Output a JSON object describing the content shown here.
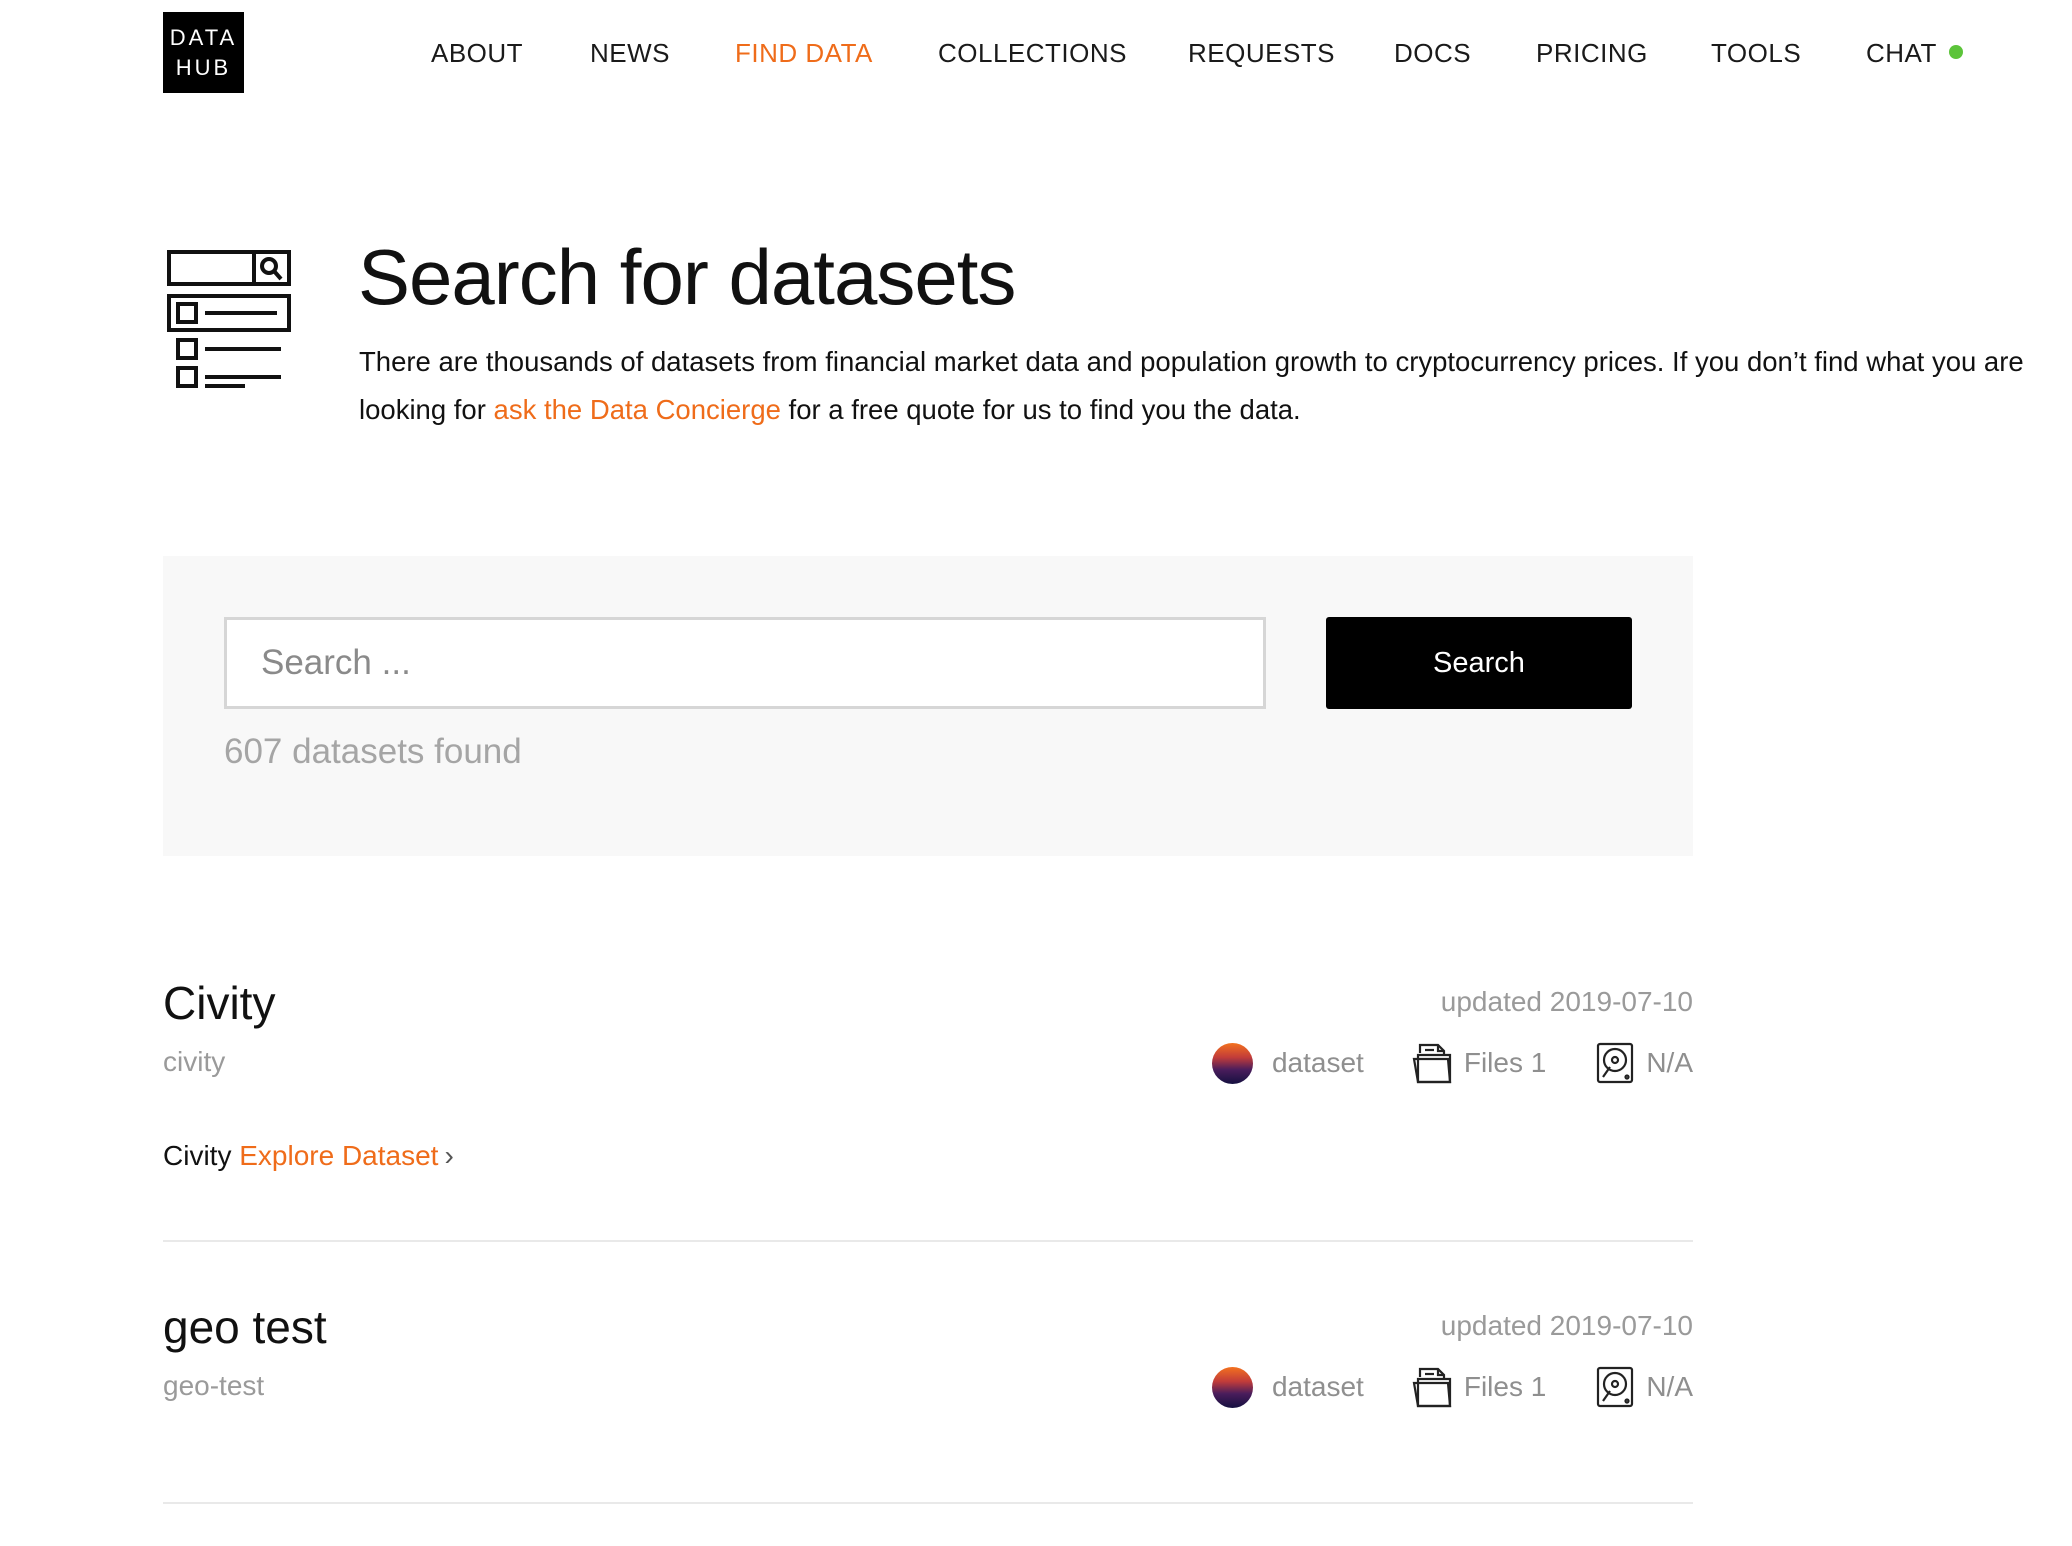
{
  "logo": {
    "line1": "DATA",
    "line2": "HUB"
  },
  "nav": {
    "items": [
      {
        "label": "ABOUT"
      },
      {
        "label": "NEWS"
      },
      {
        "label": "FIND DATA",
        "active": true
      },
      {
        "label": "COLLECTIONS"
      },
      {
        "label": "REQUESTS"
      },
      {
        "label": "DOCS"
      },
      {
        "label": "PRICING"
      },
      {
        "label": "TOOLS"
      },
      {
        "label": "CHAT"
      }
    ],
    "chat_status_color": "#5cc43a"
  },
  "hero": {
    "icon": "search-results-icon",
    "title": "Search for datasets",
    "desc_before": "There are thousands of datasets from financial market data and population growth to cryptocurrency prices. If you don’t find what you are looking for ",
    "desc_link": "ask the Data Concierge",
    "desc_after": " for a free quote for us to find you the data."
  },
  "search": {
    "placeholder": "Search ...",
    "value": "",
    "button_label": "Search",
    "results_count": "607 datasets found"
  },
  "results": [
    {
      "title": "Civity",
      "slug": "civity",
      "updated": "updated 2019-07-10",
      "type": "dataset",
      "files": "Files 1",
      "size": "N/A",
      "description": "Civity",
      "explore_label": "Explore Dataset",
      "chevron": "›"
    },
    {
      "title": "geo test",
      "slug": "geo-test",
      "updated": "updated 2019-07-10",
      "type": "dataset",
      "files": "Files 1",
      "size": "N/A"
    }
  ],
  "colors": {
    "accent": "#ef6c1a",
    "text": "#111111",
    "muted": "#9a9a9a",
    "panel": "#f8f8f8"
  },
  "icons": {
    "files": "files-icon",
    "size": "disk-icon",
    "type": "dataset-type-icon"
  }
}
